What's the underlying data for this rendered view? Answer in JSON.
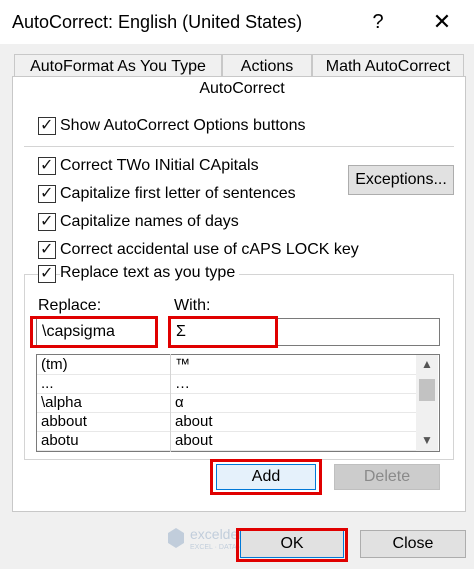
{
  "window": {
    "title": "AutoCorrect: English (United States)",
    "help_glyph": "?",
    "close_glyph": "✕"
  },
  "tabs": [
    "AutoFormat As You Type",
    "Actions",
    "Math AutoCorrect"
  ],
  "active_tab": "AutoCorrect",
  "options": {
    "show_buttons": {
      "label": "Show AutoCorrect Options buttons",
      "checked": true
    },
    "two_initial_caps": {
      "label": "Correct TWo INitial CApitals",
      "checked": true
    },
    "capitalize_first_letter": {
      "label": "Capitalize first letter of sentences",
      "checked": true
    },
    "capitalize_days": {
      "label": "Capitalize names of days",
      "checked": true
    },
    "caps_lock": {
      "label": "Correct accidental use of cAPS LOCK key",
      "checked": true
    },
    "replace_text": {
      "label": "Replace text as you type",
      "checked": true
    }
  },
  "exceptions_button": "Exceptions...",
  "replace": {
    "label": "Replace:",
    "value": "\\capsigma"
  },
  "with": {
    "label": "With:",
    "value": "Σ"
  },
  "entries": [
    {
      "replace": "(tm)",
      "with": "™"
    },
    {
      "replace": "...",
      "with": "…"
    },
    {
      "replace": "\\alpha",
      "with": "α"
    },
    {
      "replace": "abbout",
      "with": "about"
    },
    {
      "replace": "abotu",
      "with": "about"
    }
  ],
  "scroll_up_glyph": "▲",
  "scroll_down_glyph": "▼",
  "add_button": "Add",
  "delete_button": "Delete",
  "ok_button": "OK",
  "close_button": "Close",
  "watermark": {
    "brand": "exceldemy",
    "tagline": "EXCEL · DATA · BI"
  },
  "colors": {
    "highlight_red": "#e00000",
    "accent_blue": "#0078d7",
    "button_face": "#e1e1e1"
  }
}
